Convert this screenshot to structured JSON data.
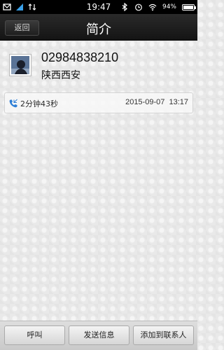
{
  "statusbar": {
    "time": "19:47",
    "battery": "94%",
    "icons": [
      "notification-icon",
      "signal-icon",
      "data-icon",
      "bluetooth-icon",
      "alarm-icon",
      "wifi-icon",
      "battery-icon"
    ]
  },
  "header": {
    "back_label": "返回",
    "title": "简介"
  },
  "contact": {
    "phone": "02984838210",
    "location": "陕西西安"
  },
  "call_log": [
    {
      "icon": "incoming-call-icon",
      "duration": "2分钟43秒",
      "datetime": "2015-09-07  13:17"
    }
  ],
  "toolbar": {
    "call_label": "呼叫",
    "message_label": "发送信息",
    "add_contact_label": "添加到联系人"
  },
  "colors": {
    "titlebar": "#1c1c1c",
    "background": "#e9e9e9",
    "call_icon": "#2f7fd6"
  }
}
